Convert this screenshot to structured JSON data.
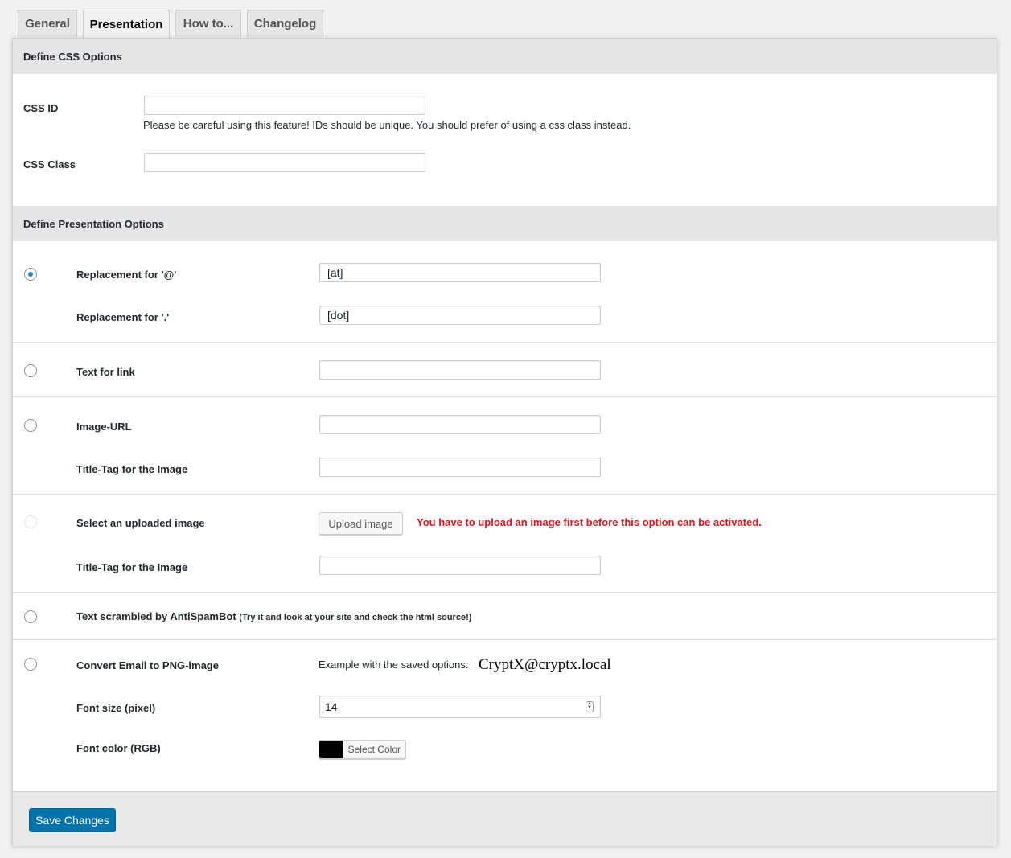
{
  "tabs": [
    "General",
    "Presentation",
    "How to...",
    "Changelog"
  ],
  "active_tab": "Presentation",
  "css_section": {
    "title": "Define CSS Options",
    "css_id_label": "CSS ID",
    "css_id_value": "",
    "css_id_hint": "Please be careful using this feature! IDs should be unique. You should prefer of using a css class instead.",
    "css_class_label": "CSS Class",
    "css_class_value": ""
  },
  "presentation_section": {
    "title": "Define Presentation Options",
    "replacement_at_label": "Replacement for '@'",
    "replacement_at_value": "[at]",
    "replacement_dot_label": "Replacement for '.'",
    "replacement_dot_value": "[dot]",
    "text_for_link_label": "Text for link",
    "text_for_link_value": "",
    "image_url_label": "Image-URL",
    "image_url_value": "",
    "image_title_label": "Title-Tag for the Image",
    "image_title_value": "",
    "uploaded_image_label": "Select an uploaded image",
    "upload_button_label": "Upload image",
    "upload_warning": "You have to upload an image first before this option can be activated.",
    "uploaded_image_title_label": "Title-Tag for the Image",
    "uploaded_image_title_value": "",
    "antispambot_label": "Text scrambled by AntiSpamBot",
    "antispambot_hint": "(Try it and look at your site and check the html source!)",
    "png_label": "Convert Email to PNG-image",
    "png_example_label": "Example with the saved options:",
    "png_example_value": "CryptX@cryptx.local",
    "font_size_label": "Font size (pixel)",
    "font_size_value": "14",
    "font_color_label": "Font color (RGB)",
    "font_color_value": "#000000",
    "select_color_label": "Select Color",
    "selected_option": "replacement"
  },
  "footer": {
    "save_label": "Save Changes"
  },
  "colors": {
    "accent": "#0073aa",
    "warning": "#e2151b"
  }
}
